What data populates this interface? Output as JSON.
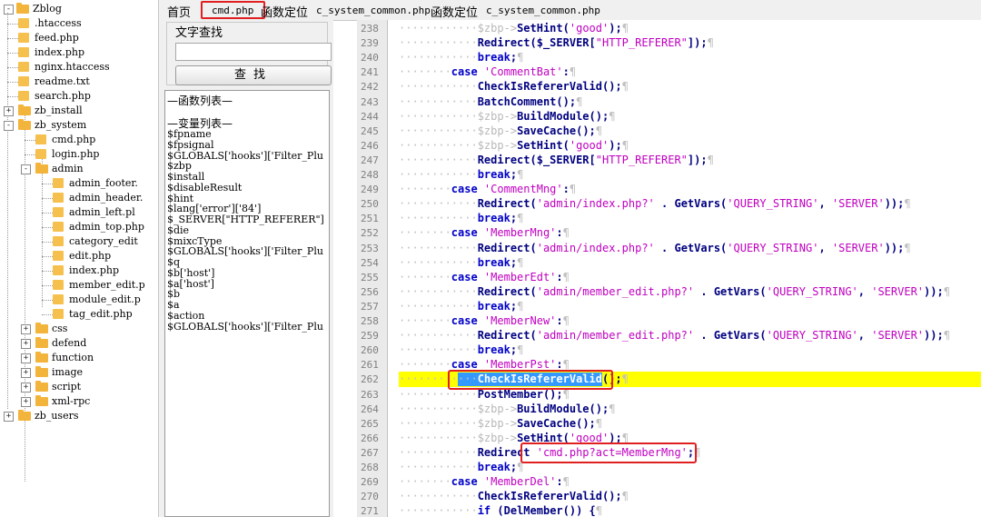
{
  "tree": {
    "root": "Zblog",
    "items": [
      {
        "label": ".htaccess",
        "kind": "file"
      },
      {
        "label": "feed.php",
        "kind": "file"
      },
      {
        "label": "index.php",
        "kind": "file"
      },
      {
        "label": "nginx.htaccess",
        "kind": "file"
      },
      {
        "label": "readme.txt",
        "kind": "file"
      },
      {
        "label": "search.php",
        "kind": "file"
      },
      {
        "label": "zb_install",
        "kind": "folder"
      },
      {
        "label": "zb_system",
        "kind": "folder"
      },
      {
        "label": "cmd.php",
        "kind": "file"
      },
      {
        "label": "login.php",
        "kind": "file"
      },
      {
        "label": "admin",
        "kind": "folder"
      },
      {
        "label": "admin_footer.",
        "kind": "file"
      },
      {
        "label": "admin_header.",
        "kind": "file"
      },
      {
        "label": "admin_left.pl",
        "kind": "file"
      },
      {
        "label": "admin_top.php",
        "kind": "file"
      },
      {
        "label": "category_edit",
        "kind": "file"
      },
      {
        "label": "edit.php",
        "kind": "file"
      },
      {
        "label": "index.php",
        "kind": "file"
      },
      {
        "label": "member_edit.p",
        "kind": "file"
      },
      {
        "label": "module_edit.p",
        "kind": "file"
      },
      {
        "label": "tag_edit.php",
        "kind": "file"
      },
      {
        "label": "css",
        "kind": "folder"
      },
      {
        "label": "defend",
        "kind": "folder"
      },
      {
        "label": "function",
        "kind": "folder"
      },
      {
        "label": "image",
        "kind": "folder"
      },
      {
        "label": "script",
        "kind": "folder"
      },
      {
        "label": "xml-rpc",
        "kind": "folder"
      },
      {
        "label": "zb_users",
        "kind": "folder"
      }
    ]
  },
  "tabs": [
    {
      "label": "首页"
    },
    {
      "label": "cmd.php"
    },
    {
      "label": "函数定位"
    },
    {
      "label": "c_system_common.php"
    },
    {
      "label": "函数定位"
    },
    {
      "label": "c_system_common.php"
    }
  ],
  "search": {
    "title": "文字查找",
    "value": "",
    "button": "查找"
  },
  "function_list": {
    "header": "—函数列表—",
    "var_header": "—变量列表—",
    "vars": [
      "$fpname",
      "$fpsignal",
      "$GLOBALS['hooks']['Filter_Plu",
      "$zbp",
      "$install",
      "$disableResult",
      "$hint",
      "$lang['error']['84']",
      "$_SERVER[\"HTTP_REFERER\"]",
      "$die",
      "$mixcType",
      "$GLOBALS['hooks']['Filter_Plu",
      "$q",
      "$b['host']",
      "$a['host']",
      "$b",
      "$a",
      "$action",
      "$GLOBALS['hooks']['Filter_Plu"
    ]
  },
  "editor": {
    "first_line": 238,
    "highlight_line": 262,
    "lines": [
      [
        [
          "ind",
          3
        ],
        [
          "sp",
          "$zbp->"
        ],
        [
          "fn",
          "SetHint"
        ],
        [
          "pn",
          "("
        ],
        [
          "st",
          "'good'"
        ],
        [
          "pn",
          ");"
        ]
      ],
      [
        [
          "ind",
          3
        ],
        [
          "fn",
          "Redirect"
        ],
        [
          "pn",
          "($_SERVER["
        ],
        [
          "st",
          "\"HTTP_REFERER\""
        ],
        [
          "pn",
          "]);"
        ]
      ],
      [
        [
          "ind",
          3
        ],
        [
          "kw",
          "break"
        ],
        [
          "pn",
          ";"
        ]
      ],
      [
        [
          "ind",
          2
        ],
        [
          "kw",
          "case "
        ],
        [
          "st",
          "'CommentBat'"
        ],
        [
          "pn",
          ":"
        ]
      ],
      [
        [
          "ind",
          3
        ],
        [
          "fn",
          "CheckIsRefererValid"
        ],
        [
          "pn",
          "();"
        ]
      ],
      [
        [
          "ind",
          3
        ],
        [
          "fn",
          "BatchComment"
        ],
        [
          "pn",
          "();"
        ]
      ],
      [
        [
          "ind",
          3
        ],
        [
          "sp",
          "$zbp->"
        ],
        [
          "fn",
          "BuildModule"
        ],
        [
          "pn",
          "();"
        ]
      ],
      [
        [
          "ind",
          3
        ],
        [
          "sp",
          "$zbp->"
        ],
        [
          "fn",
          "SaveCache"
        ],
        [
          "pn",
          "();"
        ]
      ],
      [
        [
          "ind",
          3
        ],
        [
          "sp",
          "$zbp->"
        ],
        [
          "fn",
          "SetHint"
        ],
        [
          "pn",
          "("
        ],
        [
          "st",
          "'good'"
        ],
        [
          "pn",
          ");"
        ]
      ],
      [
        [
          "ind",
          3
        ],
        [
          "fn",
          "Redirect"
        ],
        [
          "pn",
          "($_SERVER["
        ],
        [
          "st",
          "\"HTTP_REFERER\""
        ],
        [
          "pn",
          "]);"
        ]
      ],
      [
        [
          "ind",
          3
        ],
        [
          "kw",
          "break"
        ],
        [
          "pn",
          ";"
        ]
      ],
      [
        [
          "ind",
          2
        ],
        [
          "kw",
          "case "
        ],
        [
          "st",
          "'CommentMng'"
        ],
        [
          "pn",
          ":"
        ]
      ],
      [
        [
          "ind",
          3
        ],
        [
          "fn",
          "Redirect"
        ],
        [
          "pn",
          "("
        ],
        [
          "st",
          "'admin/index.php?'"
        ],
        [
          "pn",
          " . "
        ],
        [
          "fn",
          "GetVars"
        ],
        [
          "pn",
          "("
        ],
        [
          "st",
          "'QUERY_STRING'"
        ],
        [
          "pn",
          ", "
        ],
        [
          "st",
          "'SERVER'"
        ],
        [
          "pn",
          "));"
        ]
      ],
      [
        [
          "ind",
          3
        ],
        [
          "kw",
          "break"
        ],
        [
          "pn",
          ";"
        ]
      ],
      [
        [
          "ind",
          2
        ],
        [
          "kw",
          "case "
        ],
        [
          "st",
          "'MemberMng'"
        ],
        [
          "pn",
          ":"
        ]
      ],
      [
        [
          "ind",
          3
        ],
        [
          "fn",
          "Redirect"
        ],
        [
          "pn",
          "("
        ],
        [
          "st",
          "'admin/index.php?'"
        ],
        [
          "pn",
          " . "
        ],
        [
          "fn",
          "GetVars"
        ],
        [
          "pn",
          "("
        ],
        [
          "st",
          "'QUERY_STRING'"
        ],
        [
          "pn",
          ", "
        ],
        [
          "st",
          "'SERVER'"
        ],
        [
          "pn",
          "));"
        ]
      ],
      [
        [
          "ind",
          3
        ],
        [
          "kw",
          "break"
        ],
        [
          "pn",
          ";"
        ]
      ],
      [
        [
          "ind",
          2
        ],
        [
          "kw",
          "case "
        ],
        [
          "st",
          "'MemberEdt'"
        ],
        [
          "pn",
          ":"
        ]
      ],
      [
        [
          "ind",
          3
        ],
        [
          "fn",
          "Redirect"
        ],
        [
          "pn",
          "("
        ],
        [
          "st",
          "'admin/member_edit.php?'"
        ],
        [
          "pn",
          " . "
        ],
        [
          "fn",
          "GetVars"
        ],
        [
          "pn",
          "("
        ],
        [
          "st",
          "'QUERY_STRING'"
        ],
        [
          "pn",
          ", "
        ],
        [
          "st",
          "'SERVER'"
        ],
        [
          "pn",
          "));"
        ]
      ],
      [
        [
          "ind",
          3
        ],
        [
          "kw",
          "break"
        ],
        [
          "pn",
          ";"
        ]
      ],
      [
        [
          "ind",
          2
        ],
        [
          "kw",
          "case "
        ],
        [
          "st",
          "'MemberNew'"
        ],
        [
          "pn",
          ":"
        ]
      ],
      [
        [
          "ind",
          3
        ],
        [
          "fn",
          "Redirect"
        ],
        [
          "pn",
          "("
        ],
        [
          "st",
          "'admin/member_edit.php?'"
        ],
        [
          "pn",
          " . "
        ],
        [
          "fn",
          "GetVars"
        ],
        [
          "pn",
          "("
        ],
        [
          "st",
          "'QUERY_STRING'"
        ],
        [
          "pn",
          ", "
        ],
        [
          "st",
          "'SERVER'"
        ],
        [
          "pn",
          "));"
        ]
      ],
      [
        [
          "ind",
          3
        ],
        [
          "kw",
          "break"
        ],
        [
          "pn",
          ";"
        ]
      ],
      [
        [
          "ind",
          2
        ],
        [
          "kw",
          "case "
        ],
        [
          "st",
          "'MemberPst'"
        ],
        [
          "pn",
          ":"
        ]
      ],
      [
        [
          "ind",
          3
        ],
        [
          "sel",
          "CheckIsRefererValid"
        ],
        [
          "pn",
          "();"
        ]
      ],
      [
        [
          "ind",
          3
        ],
        [
          "fn",
          "PostMember"
        ],
        [
          "pn",
          "();"
        ]
      ],
      [
        [
          "ind",
          3
        ],
        [
          "sp",
          "$zbp->"
        ],
        [
          "fn",
          "BuildModule"
        ],
        [
          "pn",
          "();"
        ]
      ],
      [
        [
          "ind",
          3
        ],
        [
          "sp",
          "$zbp->"
        ],
        [
          "fn",
          "SaveCache"
        ],
        [
          "pn",
          "();"
        ]
      ],
      [
        [
          "ind",
          3
        ],
        [
          "sp",
          "$zbp->"
        ],
        [
          "fn",
          "SetHint"
        ],
        [
          "pn",
          "("
        ],
        [
          "st",
          "'good'"
        ],
        [
          "pn",
          ");"
        ]
      ],
      [
        [
          "ind",
          3
        ],
        [
          "fn",
          "Redirect "
        ],
        [
          "st",
          "'cmd.php?act=MemberMng'"
        ],
        [
          "pn",
          ";"
        ]
      ],
      [
        [
          "ind",
          3
        ],
        [
          "kw",
          "break"
        ],
        [
          "pn",
          ";"
        ]
      ],
      [
        [
          "ind",
          2
        ],
        [
          "kw",
          "case "
        ],
        [
          "st",
          "'MemberDel'"
        ],
        [
          "pn",
          ":"
        ]
      ],
      [
        [
          "ind",
          3
        ],
        [
          "fn",
          "CheckIsRefererValid"
        ],
        [
          "pn",
          "();"
        ]
      ],
      [
        [
          "ind",
          3
        ],
        [
          "kw",
          "if "
        ],
        [
          "pn",
          "("
        ],
        [
          "fn",
          "DelMember"
        ],
        [
          "pn",
          "()) {"
        ]
      ]
    ]
  },
  "colors": {
    "highlight": "#ffff00",
    "selection": "#3399ff",
    "annotation": "#e02020",
    "keyword": "#0000c8",
    "string": "#c000c0"
  }
}
